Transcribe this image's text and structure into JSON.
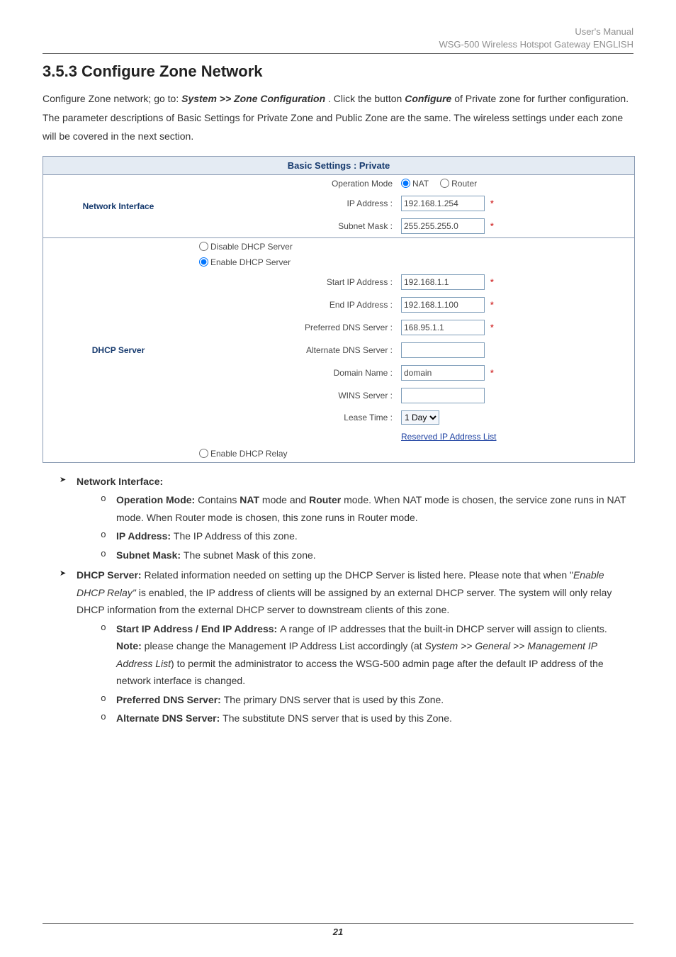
{
  "header": {
    "line1": "User's Manual",
    "line2_prefix": "WSG-500 Wireless Hotspot Gateway ",
    "line2_lang": "ENGLISH"
  },
  "section": {
    "title": "3.5.3 Configure Zone Network",
    "intro_pre": "Configure Zone network; go to: ",
    "intro_path": "System >> Zone Configuration",
    "intro_mid": ". Click the button ",
    "intro_btn": "Configure",
    "intro_post": " of Private zone for further configuration. The parameter descriptions of Basic Settings for Private Zone and Public Zone are the same. The wireless settings under each zone will be covered in the next section."
  },
  "panel": {
    "title": "Basic Settings : Private",
    "network_interface": {
      "heading": "Network Interface",
      "op_mode_label": "Operation Mode",
      "op_nat": "NAT",
      "op_router": "Router",
      "ip_label": "IP Address :",
      "ip_value": "192.168.1.254",
      "mask_label": "Subnet Mask :",
      "mask_value": "255.255.255.0"
    },
    "dhcp": {
      "heading": "DHCP Server",
      "disable": "Disable DHCP Server",
      "enable": "Enable DHCP Server",
      "start_label": "Start IP Address :",
      "start_value": "192.168.1.1",
      "end_label": "End IP Address :",
      "end_value": "192.168.1.100",
      "pdns_label": "Preferred DNS Server :",
      "pdns_value": "168.95.1.1",
      "adns_label": "Alternate DNS Server :",
      "adns_value": "",
      "domain_label": "Domain Name :",
      "domain_value": "domain",
      "wins_label": "WINS Server :",
      "wins_value": "",
      "lease_label": "Lease Time :",
      "lease_value": "1 Day",
      "reserved_link": "Reserved IP Address List",
      "relay": "Enable DHCP Relay"
    }
  },
  "bullets": {
    "ni_head": "Network Interface:",
    "opmode": {
      "label": "Operation Mode: ",
      "pre": "Contains ",
      "nat": "NAT",
      "mid": " mode and ",
      "router": "Router",
      "post": " mode. When NAT mode is chosen, the service zone runs in NAT mode. When Router mode is chosen, this zone runs in Router mode."
    },
    "ip": {
      "label": "IP Address: ",
      "text": "The IP Address of this zone."
    },
    "mask": {
      "label": "Subnet Mask: ",
      "text": "The subnet Mask of this zone."
    },
    "dhcp_head": "DHCP Server: ",
    "dhcp_text_pre": "Related information needed on setting up the DHCP Server is listed here. Please note that when \"",
    "dhcp_text_em": "Enable DHCP Relay\"",
    "dhcp_text_post": " is enabled, the IP address of clients will be assigned by an external DHCP server. The system will only relay DHCP information from the external DHCP server to downstream clients of this zone.",
    "startend": {
      "label": "Start IP Address / End IP Address: ",
      "text": "A range of IP addresses that the built-in DHCP server will assign to clients.",
      "note_label": "Note:",
      "note_pre": " please change the Management IP Address List accordingly (at ",
      "note_path": "System >> General >> Management IP Address List",
      "note_post": ") to permit the administrator to access the WSG-500 admin page after the default IP address of the network interface is changed."
    },
    "pdns": {
      "label": "Preferred DNS Server: ",
      "text": "The primary DNS server that is used by this Zone."
    },
    "adns": {
      "label": "Alternate DNS Server: ",
      "text": "The substitute DNS server that is used by this Zone."
    }
  },
  "footer": {
    "page": "21"
  }
}
